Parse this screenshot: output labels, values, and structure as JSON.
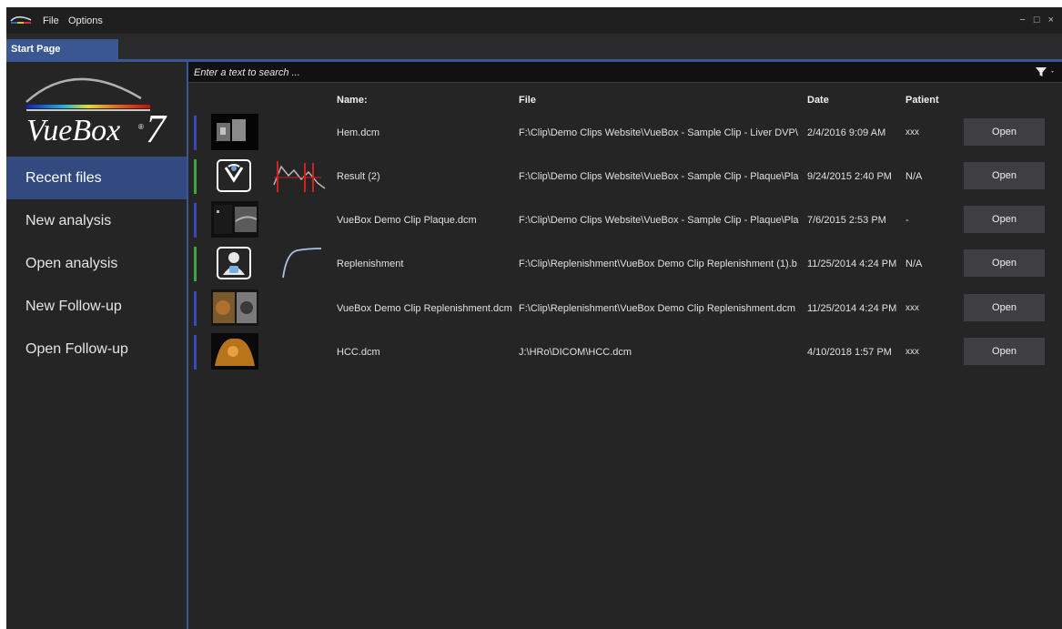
{
  "menu": {
    "file": "File",
    "options": "Options"
  },
  "window_controls": "− □ ×",
  "tab": {
    "label": "Start Page"
  },
  "logo": {
    "wordmark": "VueBox",
    "version": "7",
    "registered": "®"
  },
  "sidebar": {
    "items": [
      {
        "label": "Recent files",
        "active": true
      },
      {
        "label": "New analysis",
        "active": false
      },
      {
        "label": "Open analysis",
        "active": false
      },
      {
        "label": "New Follow-up",
        "active": false
      },
      {
        "label": "Open Follow-up",
        "active": false
      }
    ]
  },
  "search": {
    "placeholder": "Enter a text to search ..."
  },
  "table": {
    "headers": {
      "name": "Name:",
      "file": "File",
      "date": "Date",
      "patient": "Patient"
    },
    "rows": [
      {
        "name": "Hem.dcm",
        "file": "F:\\Clip\\Demo Clips Website\\VueBox - Sample Clip - Liver DVP\\",
        "date": "2/4/2016 9:09 AM",
        "patient": "xxx",
        "action": "Open",
        "type": "clip",
        "bar_color": "#3b46b8"
      },
      {
        "name": "Result (2)",
        "file": "F:\\Clip\\Demo Clips Website\\VueBox - Sample Clip - Plaque\\Pla",
        "date": "9/24/2015 2:40 PM",
        "patient": "N/A",
        "action": "Open",
        "type": "analysis",
        "bar_color": "#3fa63f"
      },
      {
        "name": "VueBox Demo Clip Plaque.dcm",
        "file": "F:\\Clip\\Demo Clips Website\\VueBox - Sample Clip - Plaque\\Pla",
        "date": "7/6/2015 2:53 PM",
        "patient": "-",
        "action": "Open",
        "type": "clip",
        "bar_color": "#3b46b8"
      },
      {
        "name": "Replenishment",
        "file": "F:\\Clip\\Replenishment\\VueBox Demo Clip Replenishment (1).b",
        "date": "11/25/2014 4:24 PM",
        "patient": "N/A",
        "action": "Open",
        "type": "analysis",
        "bar_color": "#3fa63f"
      },
      {
        "name": "VueBox Demo Clip Replenishment.dcm",
        "file": "F:\\Clip\\Replenishment\\VueBox Demo Clip Replenishment.dcm",
        "date": "11/25/2014 4:24 PM",
        "patient": "xxx",
        "action": "Open",
        "type": "clip",
        "bar_color": "#3b46b8"
      },
      {
        "name": "HCC.dcm",
        "file": "J:\\HRo\\DICOM\\HCC.dcm",
        "date": "4/10/2018 1:57 PM",
        "patient": "xxx",
        "action": "Open",
        "type": "clip",
        "bar_color": "#3b46b8"
      }
    ]
  },
  "colors": {
    "accent": "#3a5792",
    "clip_bar": "#3b46b8",
    "analysis_bar": "#3fa63f",
    "background": "#252526"
  }
}
